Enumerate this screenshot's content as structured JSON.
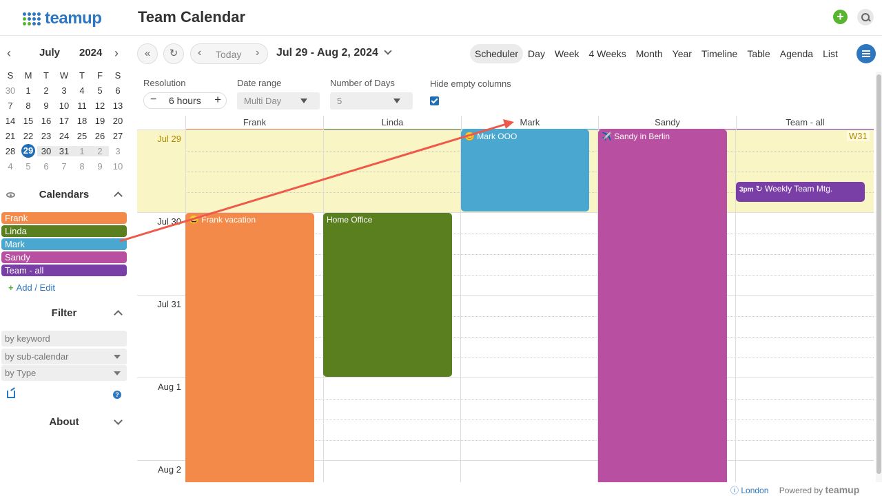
{
  "app": {
    "name": "teamup",
    "title": "Team Calendar"
  },
  "mini_calendar": {
    "month": "July",
    "year": "2024",
    "weekdays": [
      "S",
      "M",
      "T",
      "W",
      "T",
      "F",
      "S"
    ],
    "weeks": [
      [
        "30",
        "1",
        "2",
        "3",
        "4",
        "5",
        "6"
      ],
      [
        "7",
        "8",
        "9",
        "10",
        "11",
        "12",
        "13"
      ],
      [
        "14",
        "15",
        "16",
        "17",
        "18",
        "19",
        "20"
      ],
      [
        "21",
        "22",
        "23",
        "24",
        "25",
        "26",
        "27"
      ],
      [
        "28",
        "29",
        "30",
        "31",
        "1",
        "2",
        "3"
      ],
      [
        "4",
        "5",
        "6",
        "7",
        "8",
        "9",
        "10"
      ]
    ]
  },
  "calendars": {
    "title": "Calendars",
    "items": [
      {
        "name": "Frank",
        "color": "#f48a4a"
      },
      {
        "name": "Linda",
        "color": "#5a7f1f"
      },
      {
        "name": "Mark",
        "color": "#4aa8d0"
      },
      {
        "name": "Sandy",
        "color": "#b94fa0"
      },
      {
        "name": "Team - all",
        "color": "#7a3fa6"
      }
    ],
    "add_edit": "Add / Edit"
  },
  "filter": {
    "title": "Filter",
    "keyword_placeholder": "by keyword",
    "subcalendar_placeholder": "by sub-calendar",
    "type_placeholder": "by Type"
  },
  "about": {
    "title": "About"
  },
  "toolbar": {
    "today": "Today",
    "range": "Jul 29 - Aug 2, 2024",
    "views": [
      "Scheduler",
      "Day",
      "Week",
      "4 Weeks",
      "Month",
      "Year",
      "Timeline",
      "Table",
      "Agenda",
      "List"
    ],
    "active_view": "Scheduler"
  },
  "settings": {
    "resolution_label": "Resolution",
    "resolution_value": "6 hours",
    "date_range_label": "Date range",
    "date_range_value": "Multi Day",
    "days_label": "Number of Days",
    "days_value": "5",
    "hide_empty_label": "Hide empty columns",
    "hide_empty_checked": true
  },
  "scheduler": {
    "columns": [
      {
        "name": "Frank",
        "color": "#f48a4a"
      },
      {
        "name": "Linda",
        "color": "#5a7f1f"
      },
      {
        "name": "Mark",
        "color": "#4aa8d0"
      },
      {
        "name": "Sandy",
        "color": "#b94fa0"
      },
      {
        "name": "Team - all",
        "color": "#7a3fa6"
      }
    ],
    "rows": [
      "Jul 29",
      "Jul 30",
      "Jul 31",
      "Aug 1",
      "Aug 2"
    ],
    "week_badge": "W31",
    "events": [
      {
        "title": "Mark OOO",
        "icon": "😊",
        "color": "#4aa8d0"
      },
      {
        "title": "Sandy in Berlin",
        "icon": "✈️",
        "color": "#b94fa0"
      },
      {
        "title": "Weekly Team Mtg.",
        "time": "3pm",
        "icon": "↻",
        "color": "#7a3fa6"
      },
      {
        "title": "Frank vacation",
        "icon": "😀",
        "color": "#f48a4a"
      },
      {
        "title": "Home Office",
        "color": "#5a7f1f"
      }
    ]
  },
  "footer": {
    "timezone": "London",
    "powered": "Powered by",
    "brand": "teamup"
  }
}
